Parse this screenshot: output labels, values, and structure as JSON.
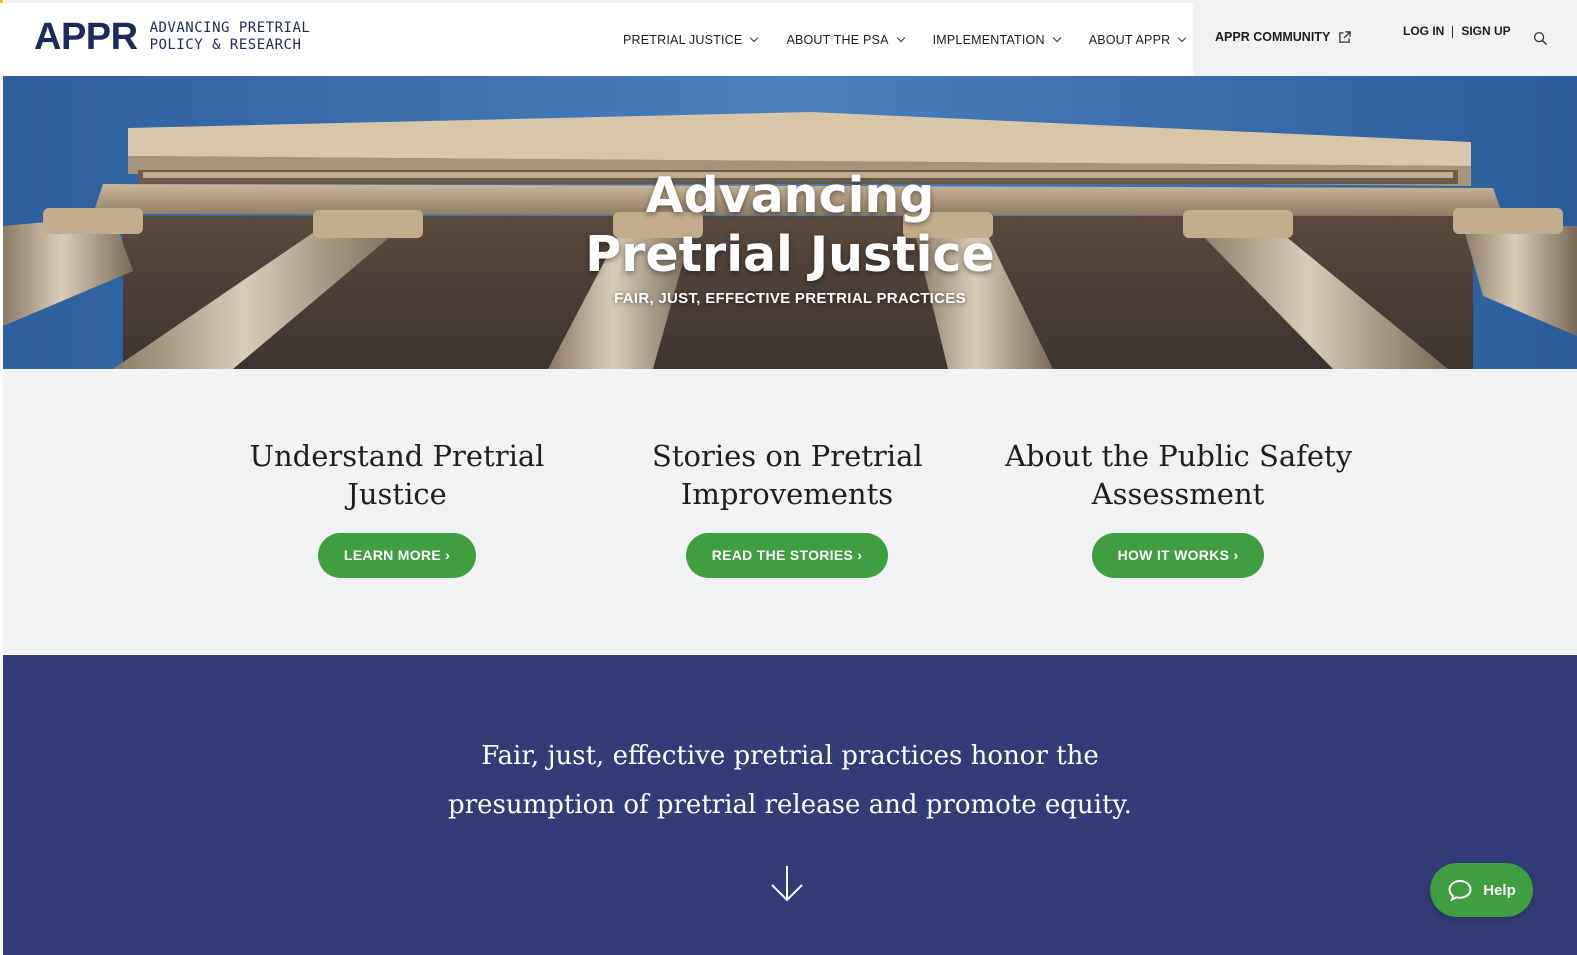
{
  "brand": {
    "mark": "APPR",
    "line1": "ADVANCING PRETRIAL",
    "line2": "POLICY & RESEARCH",
    "accent_color": "#f5c518",
    "navy": "#1e2a5e"
  },
  "nav": {
    "items": [
      {
        "label": "PRETRIAL JUSTICE"
      },
      {
        "label": "ABOUT THE PSA"
      },
      {
        "label": "IMPLEMENTATION"
      },
      {
        "label": "ABOUT APPR"
      }
    ],
    "community_label": "APPR COMMUNITY",
    "login_label": "LOG IN",
    "signup_label": "SIGN UP"
  },
  "hero": {
    "title_line1": "Advancing",
    "title_line2": "Pretrial Justice",
    "subtitle": "FAIR, JUST, EFFECTIVE PRETRIAL PRACTICES"
  },
  "cards": [
    {
      "title_line1": "Understand Pretrial",
      "title_line2": "Justice",
      "button": "LEARN MORE ›"
    },
    {
      "title_line1": "Stories on Pretrial",
      "title_line2": "Improvements",
      "button": "READ THE STORIES ›"
    },
    {
      "title_line1": "About the Public Safety",
      "title_line2": "Assessment",
      "button": "HOW IT WORKS ›"
    }
  ],
  "band": {
    "quote_line1": "Fair, just, effective pretrial practices honor the",
    "quote_line2": "presumption of pretrial release and promote equity.",
    "background": "#333c79"
  },
  "help": {
    "label": "Help",
    "color": "#3e9e40"
  }
}
